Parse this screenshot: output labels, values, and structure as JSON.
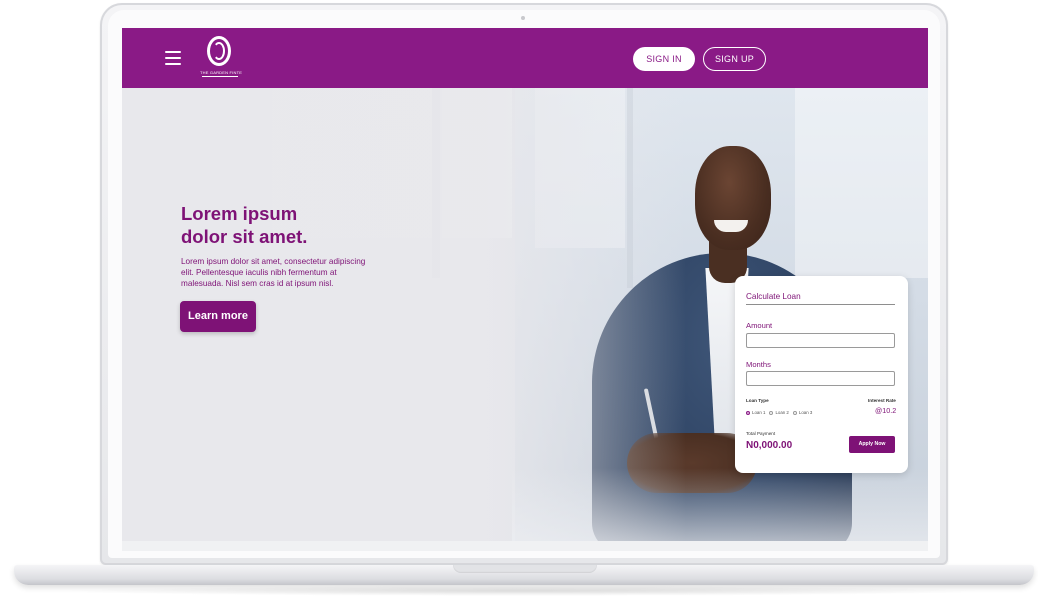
{
  "navbar": {
    "logo_text": "THE GARDEN FINTE",
    "signin_label": "SIGN IN",
    "signup_label": "SIGN UP",
    "menu_icon": "hamburger-icon",
    "brand_color": "#8a1a86"
  },
  "hero": {
    "title_line1": "Lorem ipsum",
    "title_line2": "dolor sit amet.",
    "body": "Lorem ipsum dolor sit amet, consectetur adipiscing elit. Pellentesque iaculis nibh fermentum at malesuada. Nisl sem cras id at ipsum nisl.",
    "cta_label": "Learn more"
  },
  "loan_calculator": {
    "title": "Calculate Loan",
    "amount_label": "Amount",
    "amount_value": "",
    "months_label": "Months",
    "months_value": "",
    "loan_type_label": "Loan Type",
    "loan_options": [
      "Loan 1",
      "Loan 2",
      "Loan 3"
    ],
    "selected_option": "Loan 1",
    "interest_label": "Interest Rate",
    "interest_value": "@10.2",
    "total_label": "Total Payment",
    "total_value": "N0,000.00",
    "apply_label": "Apply Now"
  }
}
